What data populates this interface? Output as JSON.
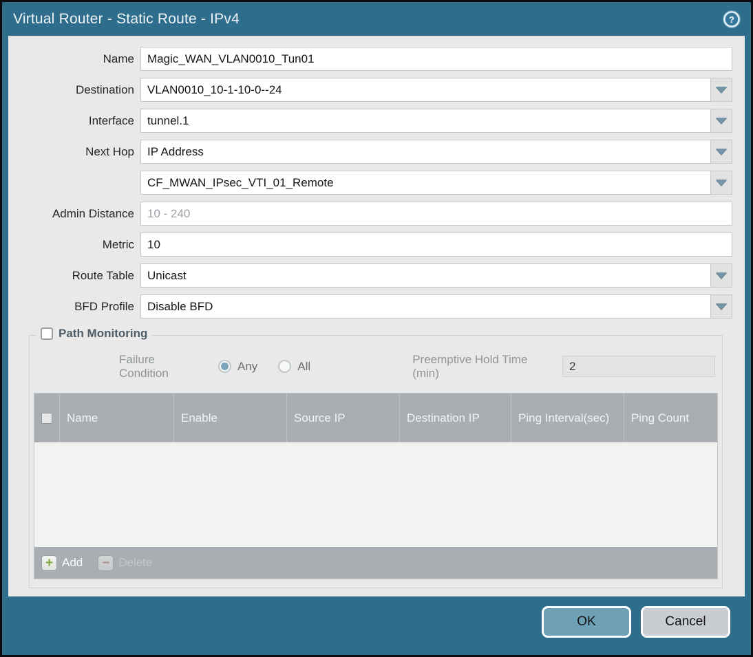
{
  "window": {
    "title": "Virtual Router - Static Route - IPv4"
  },
  "form": {
    "name": {
      "label": "Name",
      "value": "Magic_WAN_VLAN0010_Tun01"
    },
    "destination": {
      "label": "Destination",
      "value": "VLAN0010_10-1-10-0--24"
    },
    "interface": {
      "label": "Interface",
      "value": "tunnel.1"
    },
    "next_hop": {
      "label": "Next Hop",
      "value": "IP Address"
    },
    "next_hop_address": {
      "label": "",
      "value": "CF_MWAN_IPsec_VTI_01_Remote"
    },
    "admin_distance": {
      "label": "Admin Distance",
      "value": "",
      "placeholder": "10 - 240"
    },
    "metric": {
      "label": "Metric",
      "value": "10"
    },
    "route_table": {
      "label": "Route Table",
      "value": "Unicast"
    },
    "bfd_profile": {
      "label": "BFD Profile",
      "value": "Disable BFD"
    }
  },
  "path_monitoring": {
    "title": "Path Monitoring",
    "checked": false,
    "failure_condition": {
      "label": "Failure Condition",
      "options": [
        {
          "label": "Any",
          "selected": true
        },
        {
          "label": "All",
          "selected": false
        }
      ]
    },
    "preemptive_hold_time": {
      "label": "Preemptive Hold Time (min)",
      "value": "2"
    },
    "table": {
      "columns": [
        "Name",
        "Enable",
        "Source IP",
        "Destination IP",
        "Ping Interval(sec)",
        "Ping Count"
      ],
      "rows": [],
      "add_label": "Add",
      "delete_label": "Delete"
    }
  },
  "footer": {
    "ok_label": "OK",
    "cancel_label": "Cancel"
  },
  "icons": {
    "help": "help-icon",
    "dropdown": "chevron-down-icon",
    "add": "plus-icon",
    "delete": "minus-icon"
  },
  "colors": {
    "chrome_teal": "#2e6d8c",
    "content_bg": "#e9e9e9",
    "table_header_bg": "#a9aeb2",
    "ok_button_bg": "#6fa1b6",
    "cancel_button_bg": "#c9cdd1",
    "add_icon_green": "#7da33c",
    "delete_icon_red": "#b0756b",
    "radio_selected": "#7aa4ba"
  }
}
